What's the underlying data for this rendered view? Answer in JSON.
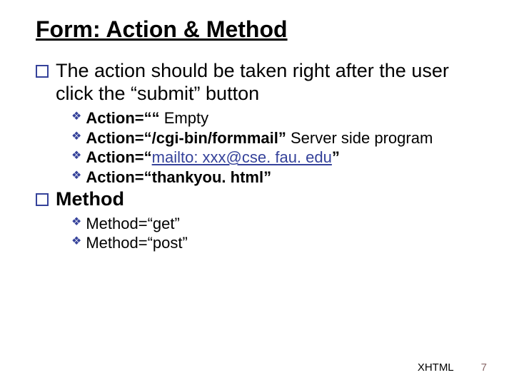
{
  "title": "Form: Action & Method",
  "items": [
    {
      "text": "The action should be taken right after the user click the “submit” button",
      "sub": [
        {
          "strong": "Action=““",
          "rest": " Empty"
        },
        {
          "strong": "Action=“/cgi-bin/formmail”",
          "rest": " Server side program"
        },
        {
          "strong_pre": "Action=“",
          "link": "mailto: xxx@cse. fau. edu",
          "strong_post": "”"
        },
        {
          "strong": "Action=“thankyou. html”"
        }
      ]
    },
    {
      "text": "Method",
      "sub": [
        {
          "plain": "Method=“get”"
        },
        {
          "plain": "Method=“post”"
        }
      ]
    }
  ],
  "footer": {
    "label": "XHTML",
    "page": "7"
  }
}
